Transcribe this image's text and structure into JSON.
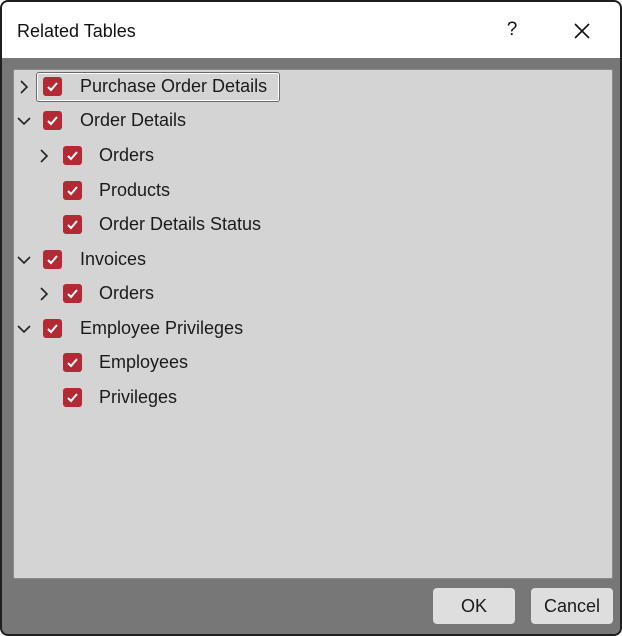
{
  "dialog": {
    "title": "Related Tables",
    "help_label": "?",
    "close_icon": "close-icon"
  },
  "tree": {
    "items": [
      {
        "label": "Purchase Order Details",
        "checked": true,
        "expander": "collapsed",
        "focused": true
      },
      {
        "label": "Order Details",
        "checked": true,
        "expander": "expanded"
      },
      {
        "label": "Orders",
        "checked": true,
        "expander": "collapsed"
      },
      {
        "label": "Products",
        "checked": true,
        "expander": "none"
      },
      {
        "label": "Order Details Status",
        "checked": true,
        "expander": "none"
      },
      {
        "label": "Invoices",
        "checked": true,
        "expander": "expanded"
      },
      {
        "label": "Orders",
        "checked": true,
        "expander": "collapsed"
      },
      {
        "label": "Employee Privileges",
        "checked": true,
        "expander": "expanded"
      },
      {
        "label": "Employees",
        "checked": true,
        "expander": "none"
      },
      {
        "label": "Privileges",
        "checked": true,
        "expander": "none"
      }
    ]
  },
  "buttons": {
    "ok_label": "OK",
    "cancel_label": "Cancel"
  },
  "colors": {
    "checkbox": "#b32a35",
    "panel": "#d4d4d4",
    "footer": "#777777"
  }
}
